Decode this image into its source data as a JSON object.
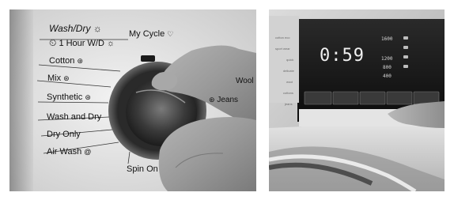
{
  "left_photo": {
    "dial_labels": {
      "wash_dry": "Wash/Dry",
      "one_hour": "1 Hour W/D",
      "my_cycle": "My Cycle",
      "cotton": "Cotton",
      "mix": "Mix",
      "synthetic": "Synthetic",
      "wash_and_dry": "Wash and Dry",
      "dry_only": "Dry Only",
      "air_wash": "Air Wash",
      "spin_on": "Spin On",
      "wool": "Wool",
      "jeans": "Jeans"
    },
    "icons": [
      "sun-icon",
      "clock-icon",
      "heart-icon",
      "shirt-icon",
      "spiral-icon"
    ]
  },
  "right_photo": {
    "display": {
      "time": "0:59",
      "spin_speeds": [
        "1600",
        "1200",
        "800",
        "400"
      ]
    },
    "panel_labels": [
      "cotton eco",
      "sport wear",
      "quick",
      "delicate",
      "wool",
      "cottons",
      "jeans"
    ]
  }
}
